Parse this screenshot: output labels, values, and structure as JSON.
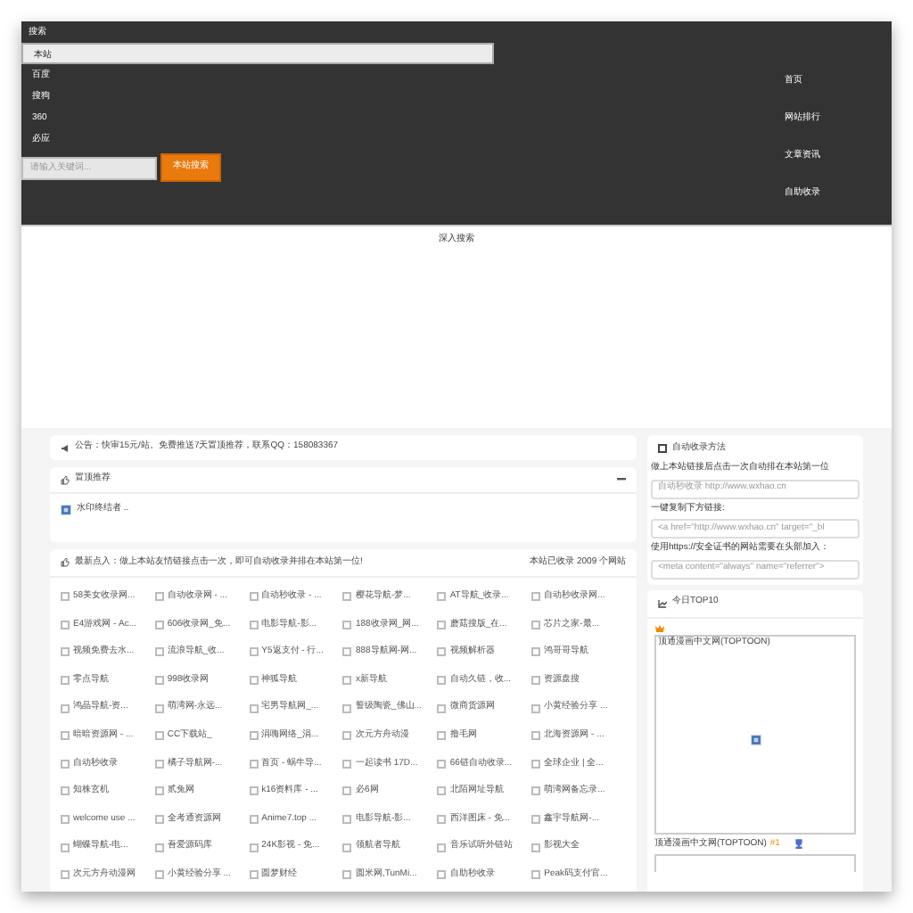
{
  "header": {
    "search_label": "搜索",
    "engines": [
      {
        "label": "本站",
        "selected": true
      },
      {
        "label": "百度",
        "selected": false
      },
      {
        "label": "搜狗",
        "selected": false
      },
      {
        "label": "360",
        "selected": false
      },
      {
        "label": "必应",
        "selected": false
      }
    ],
    "search_field": {
      "placeholder": "请输入关键词..."
    },
    "search_button": "本站搜索",
    "nav": [
      "首页",
      "网站排行",
      "文章资讯",
      "自助收录"
    ]
  },
  "deep_search": "深入搜索",
  "notice": "公告：快审15元/站。免费推送7天置顶推荐，联系QQ：158083367",
  "pinned": {
    "title": "置顶推荐",
    "items": [
      "水印终结者 .."
    ]
  },
  "latest": {
    "title": "最新点入：做上本站友情链接点击一次，即可自动收录并排在本站第一位!",
    "count": "本站已收录 2009 个网站",
    "sites": [
      {
        "label": "58美女收录网...",
        "checked": false
      },
      {
        "label": "自动收录网 - ...",
        "checked": false
      },
      {
        "label": "自动秒收录 - ...",
        "checked": false
      },
      {
        "label": "樱花导航-梦...",
        "checked": false
      },
      {
        "label": "AT导航_收录...",
        "checked": false
      },
      {
        "label": "自动秒收录网...",
        "checked": false
      },
      {
        "label": "E4游戏网 - Ac...",
        "checked": false
      },
      {
        "label": "606收录网_免...",
        "checked": false
      },
      {
        "label": "电影导航-影...",
        "checked": false
      },
      {
        "label": "188收录网_网...",
        "checked": false
      },
      {
        "label": "蘑菇搜版_在...",
        "checked": false
      },
      {
        "label": "芯片之家-最...",
        "checked": false
      },
      {
        "label": "视频免费去水...",
        "checked": false
      },
      {
        "label": "流浪导航_收...",
        "checked": false
      },
      {
        "label": "Y5返支付 - 行...",
        "checked": false
      },
      {
        "label": "888导航网-网...",
        "checked": false
      },
      {
        "label": "视频解析器",
        "checked": false
      },
      {
        "label": "鸿哥哥导航",
        "checked": false
      },
      {
        "label": "零点导航",
        "checked": false
      },
      {
        "label": "998收录网",
        "checked": false
      },
      {
        "label": "神狐导航",
        "checked": false
      },
      {
        "label": "x新导航",
        "checked": false
      },
      {
        "label": "自动久链，收...",
        "checked": false
      },
      {
        "label": "资源盘搜",
        "checked": false
      },
      {
        "label": "鸿晶导航-资...",
        "checked": false
      },
      {
        "label": "萌湾网-永远...",
        "checked": false
      },
      {
        "label": "宅男导航网_...",
        "checked": false
      },
      {
        "label": "誓级陶瓷_佛山...",
        "checked": false
      },
      {
        "label": "微商货源网",
        "checked": false
      },
      {
        "label": "小黄经验分享 ...",
        "checked": false
      },
      {
        "label": "暗暗资源网 - ...",
        "checked": false
      },
      {
        "label": "CC下载站_",
        "checked": false
      },
      {
        "label": "涓嗨网络_涓...",
        "checked": false
      },
      {
        "label": "次元方舟动漫",
        "checked": false
      },
      {
        "label": "撸毛网",
        "checked": false
      },
      {
        "label": "北海资源网 - ...",
        "checked": false
      },
      {
        "label": "自动秒收录",
        "checked": false
      },
      {
        "label": "橘子导航网-...",
        "checked": false
      },
      {
        "label": "首页 - 蜗牛导...",
        "checked": false
      },
      {
        "label": "一起读书 17D...",
        "checked": false
      },
      {
        "label": "66链自动收录...",
        "checked": false
      },
      {
        "label": "全球企业 | 全...",
        "checked": false
      },
      {
        "label": "知株玄机",
        "checked": false
      },
      {
        "label": "贰兔网",
        "checked": false
      },
      {
        "label": "k16资料库 - ...",
        "checked": false
      },
      {
        "label": "必6网",
        "checked": false
      },
      {
        "label": "北陌网址导航",
        "checked": false
      },
      {
        "label": "萌湾网备忘录...",
        "checked": false
      },
      {
        "label": "welcome use ...",
        "checked": false
      },
      {
        "label": "全考通资源网",
        "checked": false
      },
      {
        "label": "Anime7.top ...",
        "checked": false
      },
      {
        "label": "电影导航-影...",
        "checked": false
      },
      {
        "label": "西洋图床 - 免...",
        "checked": false
      },
      {
        "label": "鑫宇导航网-...",
        "checked": false
      },
      {
        "label": "蝴蝶导航-电...",
        "checked": false
      },
      {
        "label": "吾爱源码库",
        "checked": false
      },
      {
        "label": "24K影视 - 免...",
        "checked": false
      },
      {
        "label": "领航者导航",
        "checked": false
      },
      {
        "label": "音乐试听外链站",
        "checked": false
      },
      {
        "label": "影视大全",
        "checked": false
      },
      {
        "label": "次元方舟动漫网",
        "checked": false
      },
      {
        "label": "小黄经验分享 ...",
        "checked": false
      },
      {
        "label": "圆梦财经",
        "checked": false
      },
      {
        "label": "圆米网,TunMi...",
        "checked": false
      },
      {
        "label": "自助秒收录",
        "checked": false
      },
      {
        "label": "Peak码支付官...",
        "checked": false
      }
    ]
  },
  "method": {
    "title": "自动收录方法",
    "steps": [
      {
        "kind": "text",
        "text": "做上本站链接后点击一次自动排在本站第一位"
      },
      {
        "kind": "field",
        "value": "自动秒收录 http://www.wxhao.cn"
      },
      {
        "kind": "text",
        "text": "一键复制下方链接:"
      },
      {
        "kind": "field",
        "value": "<a href=\"http://www.wxhao.cn\" target=\"_bl"
      },
      {
        "kind": "text",
        "text": "使用https://安全证书的网站需要在头部加入："
      },
      {
        "kind": "field",
        "value": "<meta content=\"always\" name=\"referrer\">"
      }
    ]
  },
  "top10": {
    "title": "今日TOP10",
    "entries": [
      {
        "image_alt": "顶通漫画中文网(TOPTOON)",
        "name": "顶通漫画中文网(TOPTOON)",
        "rank": "#1"
      }
    ]
  }
}
